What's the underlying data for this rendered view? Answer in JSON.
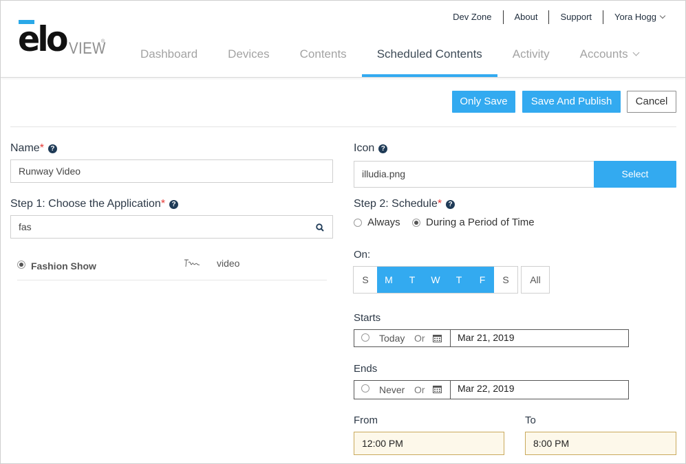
{
  "brand": {
    "logo_main": "elo",
    "logo_sub": "VIEW",
    "logo_tm": "®",
    "accent": "#33aaf0"
  },
  "top_links": [
    "Dev Zone",
    "About",
    "Support",
    "Yora Hogg"
  ],
  "nav": {
    "items": [
      "Dashboard",
      "Devices",
      "Contents",
      "Scheduled Contents",
      "Activity",
      "Accounts"
    ],
    "active": "Scheduled Contents"
  },
  "actions": {
    "only_save": "Only Save",
    "save_publish": "Save And Publish",
    "cancel": "Cancel"
  },
  "name_field": {
    "label": "Name",
    "required": "*",
    "value": "Runway Video"
  },
  "app_field": {
    "label": "Step 1: Choose the Application",
    "required": "*",
    "search_value": "fas"
  },
  "app_result": {
    "name": "Fashion Show",
    "type": "video",
    "selected": true
  },
  "icon_field": {
    "label": "Icon",
    "value": "illudia.png",
    "button": "Select"
  },
  "schedule": {
    "label": "Step 2: Schedule",
    "required": "*",
    "options": [
      "Always",
      "During a Period of Time"
    ],
    "selected": "During a Period of Time"
  },
  "on": {
    "label": "On:",
    "days": [
      {
        "letter": "S",
        "on": false
      },
      {
        "letter": "M",
        "on": true
      },
      {
        "letter": "T",
        "on": true
      },
      {
        "letter": "W",
        "on": true
      },
      {
        "letter": "T",
        "on": true
      },
      {
        "letter": "F",
        "on": true
      },
      {
        "letter": "S",
        "on": false
      }
    ],
    "all_label": "All"
  },
  "starts": {
    "label": "Starts",
    "option": "Today",
    "or": "Or",
    "date": "Mar 21, 2019"
  },
  "ends": {
    "label": "Ends",
    "option": "Never",
    "or": "Or",
    "date": "Mar 22, 2019"
  },
  "from": {
    "label": "From",
    "value": "12:00 PM"
  },
  "to": {
    "label": "To",
    "value": "8:00 PM"
  }
}
